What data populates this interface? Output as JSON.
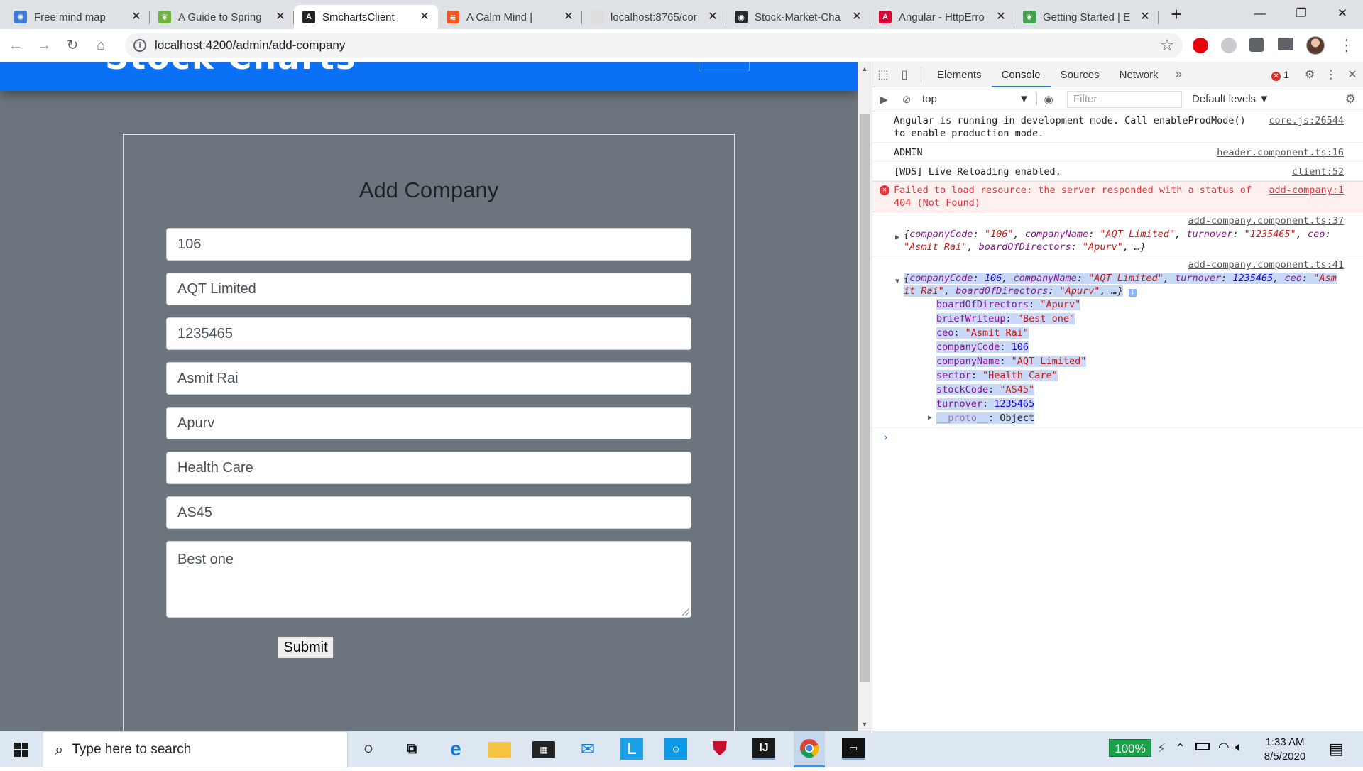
{
  "browser": {
    "tabs": [
      {
        "title": "Free mind map",
        "favicon_color": "#3b7dd8",
        "favicon_glyph": "✺"
      },
      {
        "title": "A Guide to Spring",
        "favicon_color": "#6db33f",
        "favicon_glyph": "❦"
      },
      {
        "title": "SmchartsClient",
        "favicon_color": "#222222",
        "favicon_glyph": "A",
        "active": true
      },
      {
        "title": "A Calm Mind |",
        "favicon_color": "#f25822",
        "favicon_glyph": "≋"
      },
      {
        "title": "localhost:8765/cor",
        "favicon_color": "#dddddd",
        "favicon_glyph": ""
      },
      {
        "title": "Stock-Market-Cha",
        "favicon_color": "#24292e",
        "favicon_glyph": "◉"
      },
      {
        "title": "Angular - HttpErro",
        "favicon_color": "#dd0031",
        "favicon_glyph": "A"
      },
      {
        "title": "Getting Started | E",
        "favicon_color": "#3fa34d",
        "favicon_glyph": "❦"
      }
    ],
    "url": "localhost:4200/admin/add-company"
  },
  "page": {
    "brand": "Stock Charts",
    "form_title": "Add Company",
    "fields": [
      {
        "name": "company-code",
        "value": "106"
      },
      {
        "name": "company-name",
        "value": "AQT Limited"
      },
      {
        "name": "turnover",
        "value": "1235465"
      },
      {
        "name": "ceo",
        "value": "Asmit Rai"
      },
      {
        "name": "board-of-directors",
        "value": "Apurv"
      },
      {
        "name": "sector",
        "value": "Health Care"
      },
      {
        "name": "stock-code",
        "value": "AS45"
      }
    ],
    "brief_writeup": "Best one",
    "submit_label": "Submit"
  },
  "devtools": {
    "tabs": [
      "Elements",
      "Console",
      "Sources",
      "Network"
    ],
    "active_tab": "Console",
    "error_count": "1",
    "context": "top",
    "filter_placeholder": "Filter",
    "levels": "Default levels",
    "messages": {
      "m1_text_a": "Angular is running in development mode. Call enableProdMode()",
      "m1_text_b": "to enable production mode.",
      "m1_src": "core.js:26544",
      "m2_text": "ADMIN",
      "m2_src": "header.component.ts:16",
      "m3_text": "[WDS] Live Reloading enabled.",
      "m3_src": "client:52",
      "m4_text_a": "Failed to load resource: the server responded with a status of",
      "m4_text_b": "404 (Not Found)",
      "m4_src": "add-company:1",
      "m5_src": "add-company.component.ts:37",
      "m6_src": "add-company.component.ts:41"
    },
    "object_props": [
      {
        "key": "boardOfDirectors",
        "value": "\"Apurv\"",
        "kind": "s"
      },
      {
        "key": "briefWriteup",
        "value": "\"Best one\"",
        "kind": "s"
      },
      {
        "key": "ceo",
        "value": "\"Asmit Rai\"",
        "kind": "s"
      },
      {
        "key": "companyCode",
        "value": "106",
        "kind": "n"
      },
      {
        "key": "companyName",
        "value": "\"AQT Limited\"",
        "kind": "s"
      },
      {
        "key": "sector",
        "value": "\"Health Care\"",
        "kind": "s"
      },
      {
        "key": "stockCode",
        "value": "\"AS45\"",
        "kind": "s"
      },
      {
        "key": "turnover",
        "value": "1235465",
        "kind": "n"
      }
    ],
    "proto_label": "__proto__",
    "proto_value": "Object"
  },
  "taskbar": {
    "search_placeholder": "Type here to search",
    "zoom": "100%",
    "time": "1:33 AM",
    "date": "8/5/2020"
  }
}
